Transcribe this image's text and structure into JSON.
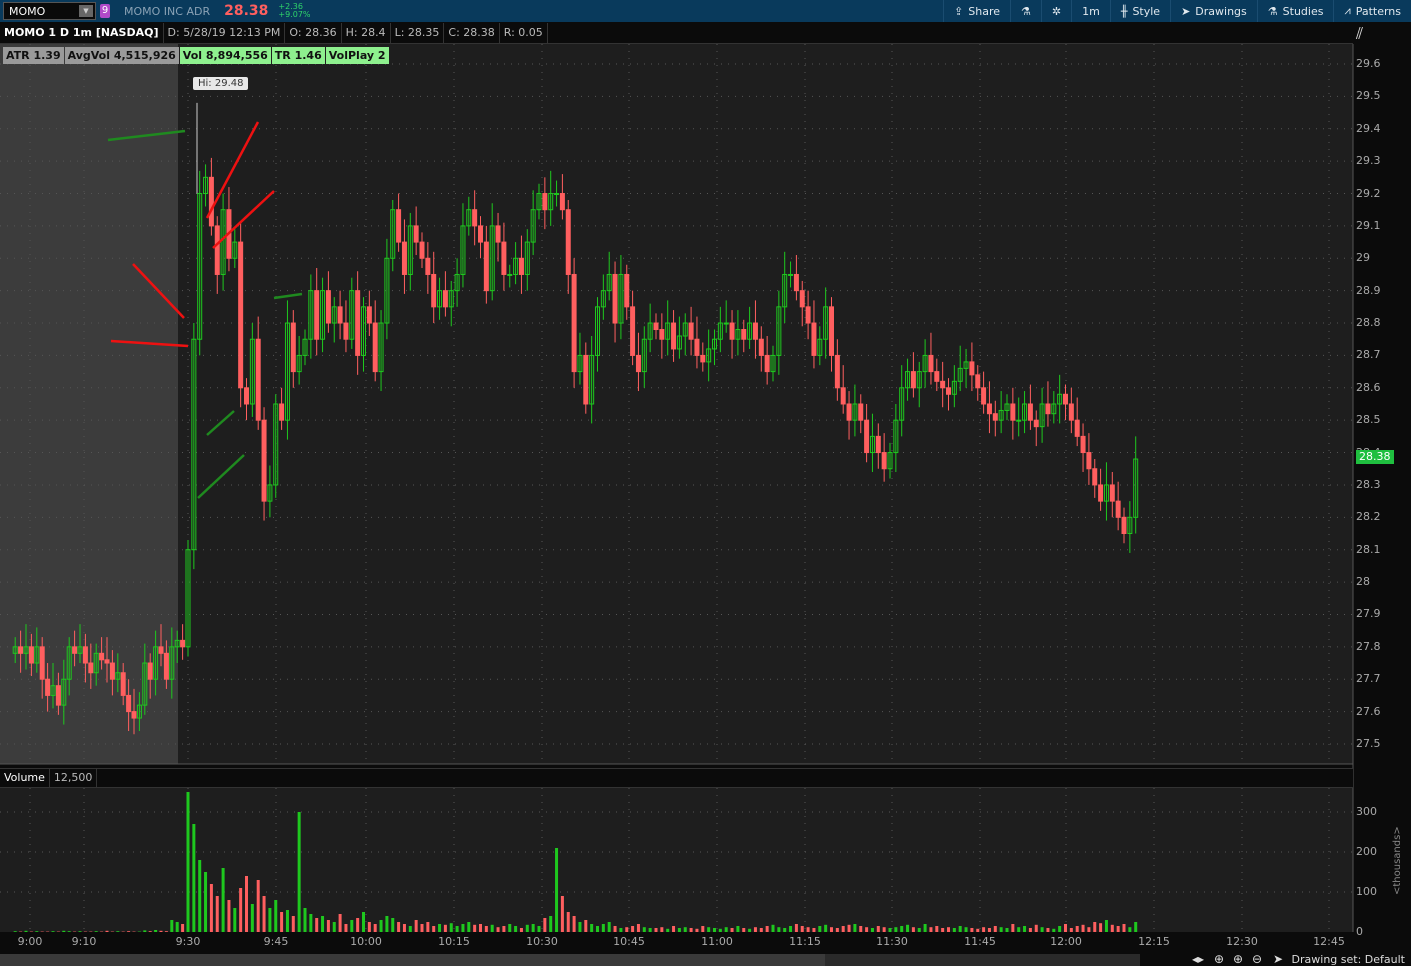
{
  "topbar": {
    "symbol": "MOMO",
    "link_badge": "9",
    "company": "MOMO INC ADR",
    "last": "28.38",
    "change": "+2.36",
    "change_pct": "+9.07%",
    "tools": [
      "Share",
      "",
      "",
      "1m",
      "Style",
      "Drawings",
      "Studies",
      "Patterns"
    ]
  },
  "info": {
    "title": "MOMO 1 D 1m [NASDAQ]",
    "date": "D: 5/28/19 12:13 PM",
    "open": "O: 28.36",
    "high": "H: 28.4",
    "low": "L: 28.35",
    "close": "C: 28.38",
    "range": "R: 0.05"
  },
  "labels": {
    "atr": "ATR 1.39",
    "avgvol": "AvgVol 4,515,926",
    "vol": "Vol 8,894,556",
    "tr": "TR 1.46",
    "volplay": "VolPlay 2"
  },
  "hi_bubble": "Hi: 29.48",
  "price_tag": "28.38",
  "volume": {
    "label": "Volume",
    "value": "12,500",
    "unit": "<thousands>",
    "ticks": [
      "300",
      "200",
      "100",
      "0"
    ]
  },
  "bottom": {
    "drawing_set": "Drawing set: Default"
  },
  "colors": {
    "up": "#1ec81e",
    "down": "#ff5f5f",
    "bg": "#1e1e1e",
    "premarket": "#3c3c3c"
  },
  "chart_data": {
    "type": "candlestick",
    "price_ticks": [
      "29.6",
      "29.5",
      "29.4",
      "29.3",
      "29.2",
      "29.1",
      "29",
      "28.9",
      "28.8",
      "28.7",
      "28.6",
      "28.5",
      "28.4",
      "28.3",
      "28.2",
      "28.1",
      "28",
      "27.9",
      "27.8",
      "27.7",
      "27.6",
      "27.5"
    ],
    "time_labels": [
      "9:00",
      "9:10",
      "9:30",
      "9:45",
      "10:00",
      "10:15",
      "10:30",
      "10:45",
      "11:00",
      "11:15",
      "11:30",
      "11:45",
      "12:00",
      "12:15",
      "12:30",
      "12:45"
    ],
    "premarket_closes": [
      27.8,
      27.78,
      27.8,
      27.75,
      27.8,
      27.7,
      27.65,
      27.68,
      27.62,
      27.7,
      27.8,
      27.78,
      27.8,
      27.75,
      27.72,
      27.78,
      27.76,
      27.75,
      27.7,
      27.72,
      27.65,
      27.6,
      27.58,
      27.62,
      27.75,
      27.7,
      27.8,
      27.78,
      27.7,
      27.8,
      27.82,
      27.8
    ],
    "session_closes": [
      28.1,
      28.75,
      29.2,
      29.25,
      29.1,
      28.95,
      29.15,
      29.0,
      29.05,
      28.6,
      28.55,
      28.75,
      28.5,
      28.25,
      28.3,
      28.55,
      28.5,
      28.8,
      28.65,
      28.7,
      28.75,
      28.9,
      28.75,
      28.9,
      28.8,
      28.85,
      28.8,
      28.75,
      28.9,
      28.7,
      28.85,
      28.8,
      28.65,
      28.8,
      29.0,
      29.15,
      29.05,
      28.95,
      29.1,
      29.05,
      29.0,
      28.95,
      28.85,
      28.9,
      28.85,
      28.9,
      28.95,
      29.1,
      29.15,
      29.1,
      29.05,
      28.9,
      29.1,
      29.05,
      28.95,
      28.95,
      29.0,
      28.95,
      29.05,
      29.15,
      29.2,
      29.15,
      29.2,
      29.2,
      29.15,
      28.95,
      28.65,
      28.7,
      28.55,
      28.7,
      28.85,
      28.9,
      28.95,
      28.8,
      28.95,
      28.85,
      28.7,
      28.65,
      28.75,
      28.8,
      28.78,
      28.75,
      28.8,
      28.72,
      28.76,
      28.8,
      28.75,
      28.7,
      28.68,
      28.72,
      28.75,
      28.8,
      28.8,
      28.75,
      28.78,
      28.75,
      28.8,
      28.75,
      28.7,
      28.65,
      28.7,
      28.85,
      28.95,
      28.95,
      28.9,
      28.85,
      28.8,
      28.7,
      28.75,
      28.85,
      28.7,
      28.6,
      28.55,
      28.5,
      28.55,
      28.5,
      28.4,
      28.45,
      28.4,
      28.35,
      28.4,
      28.5,
      28.6,
      28.65,
      28.6,
      28.65,
      28.7,
      28.65,
      28.62,
      28.6,
      28.58,
      28.62,
      28.66,
      28.68,
      28.64,
      28.6,
      28.55,
      28.52,
      28.5,
      28.53,
      28.55,
      28.5,
      28.5,
      28.55,
      28.5,
      28.48,
      28.55,
      28.52,
      28.55,
      28.58,
      28.55,
      28.5,
      28.45,
      28.4,
      28.35,
      28.3,
      28.25,
      28.3,
      28.25,
      28.2,
      28.15,
      28.2,
      28.38
    ],
    "session_volume_k": [
      350,
      270,
      180,
      150,
      120,
      90,
      160,
      80,
      60,
      110,
      140,
      70,
      130,
      90,
      60,
      80,
      50,
      55,
      40,
      300,
      60,
      45,
      35,
      40,
      30,
      25,
      45,
      20,
      30,
      35,
      50,
      25,
      20,
      30,
      40,
      35,
      25,
      20,
      15,
      30,
      20,
      25,
      15,
      20,
      18,
      22,
      15,
      20,
      25,
      18,
      20,
      15,
      18,
      12,
      15,
      20,
      15,
      10,
      18,
      20,
      15,
      35,
      40,
      210,
      90,
      50,
      40,
      25,
      30,
      20,
      15,
      20,
      25,
      15,
      10,
      12,
      15,
      20,
      12,
      10,
      10,
      12,
      8,
      15,
      10,
      12,
      10,
      8,
      15,
      12,
      10,
      8,
      12,
      10,
      15,
      10,
      8,
      12,
      10,
      15,
      18,
      12,
      10,
      15,
      20,
      15,
      12,
      10,
      15,
      18,
      12,
      10,
      15,
      18,
      20,
      15,
      12,
      10,
      15,
      12,
      10,
      12,
      15,
      18,
      12,
      10,
      20,
      12,
      15,
      10,
      12,
      10,
      15,
      12,
      10,
      8,
      12,
      10,
      15,
      12,
      10,
      20,
      12,
      15,
      10,
      18,
      12,
      10,
      8,
      15,
      20,
      10,
      15,
      18,
      12,
      25,
      22,
      30,
      18,
      15,
      20,
      12,
      25
    ],
    "premarket_volume_k": [
      2,
      1,
      3,
      1,
      2,
      1,
      1,
      2,
      1,
      3,
      2,
      1,
      2,
      1,
      1,
      2,
      1,
      3,
      1,
      2,
      1,
      2,
      1,
      1,
      4,
      2,
      5,
      3,
      2,
      30,
      25,
      20
    ],
    "high": 29.48,
    "yrange": [
      27.45,
      29.65
    ],
    "vol_range": [
      0,
      360
    ]
  }
}
